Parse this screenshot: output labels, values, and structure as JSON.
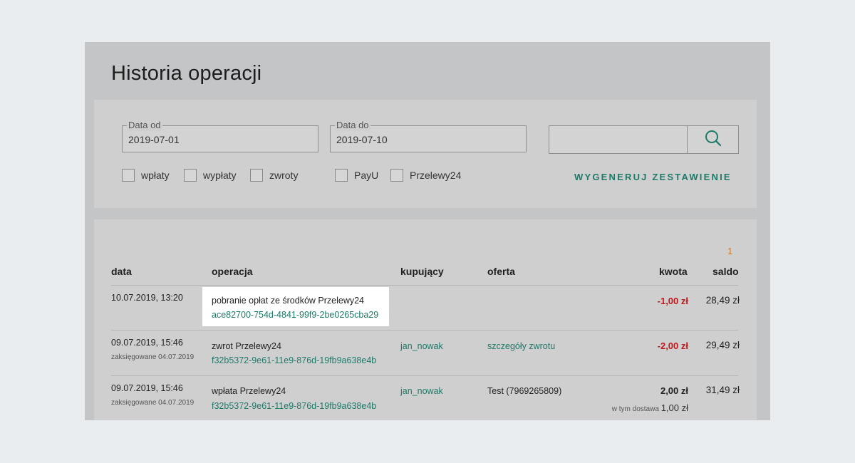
{
  "page": {
    "title": "Historia operacji"
  },
  "filters": {
    "date_from": {
      "label": "Data od",
      "value": "2019-07-01"
    },
    "date_to": {
      "label": "Data do",
      "value": "2019-07-10"
    },
    "search": {
      "value": "",
      "icon": "search-icon"
    },
    "checkboxes": [
      {
        "label": "wpłaty",
        "checked": false
      },
      {
        "label": "wypłaty",
        "checked": false
      },
      {
        "label": "zwroty",
        "checked": false
      },
      {
        "label": "PayU",
        "checked": false
      },
      {
        "label": "Przelewy24",
        "checked": false
      }
    ],
    "generate_label": "WYGENERUJ ZESTAWIENIE"
  },
  "table": {
    "page_number": "1",
    "headers": {
      "data": "data",
      "operacja": "operacja",
      "kupujacy": "kupujący",
      "oferta": "oferta",
      "kwota": "kwota",
      "saldo": "saldo"
    },
    "rows": [
      {
        "date": "10.07.2019, 13:20",
        "posted": "",
        "operation": "pobranie opłat ze środków Przelewy24",
        "operation_id": "ace82700-754d-4841-99f9-2be0265cba29",
        "buyer": "",
        "offer": "",
        "amount": "-1,00 zł",
        "amount_note": "",
        "balance": "28,49 zł"
      },
      {
        "date": "09.07.2019, 15:46",
        "posted": "zaksięgowane 04.07.2019",
        "operation": "zwrot Przelewy24",
        "operation_id": "f32b5372-9e61-11e9-876d-19fb9a638e4b",
        "buyer": "jan_nowak",
        "offer": "szczegóły zwrotu",
        "amount": "-2,00 zł",
        "amount_note": "",
        "balance": "29,49 zł"
      },
      {
        "date": "09.07.2019, 15:46",
        "posted": "zaksięgowane 04.07.2019",
        "operation": "wpłata Przelewy24",
        "operation_id": "f32b5372-9e61-11e9-876d-19fb9a638e4b",
        "buyer": "jan_nowak",
        "offer": "Test (7969265809)",
        "amount": "2,00 zł",
        "amount_note_label": "w tym dostawa",
        "amount_note_value": "1,00 zł",
        "balance": "31,49 zł"
      }
    ]
  },
  "colors": {
    "accent": "#1e7a68",
    "negative": "#c1181b",
    "pager": "#d5771c"
  }
}
